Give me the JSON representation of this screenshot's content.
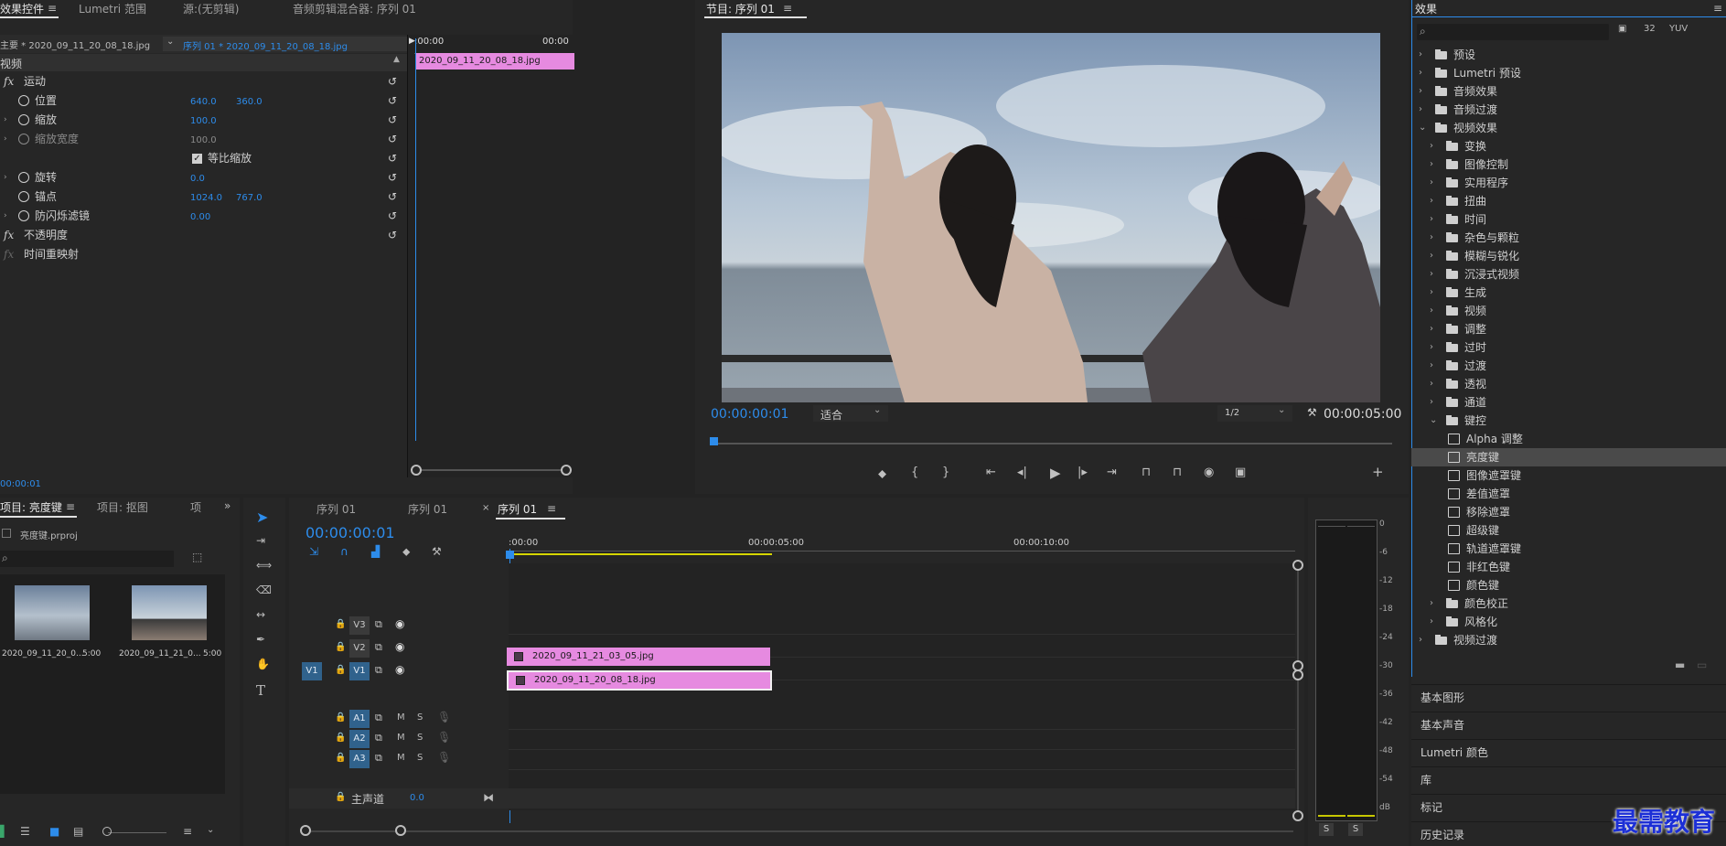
{
  "effect_controls": {
    "tabs": [
      "效果控件",
      "Lumetri 范围",
      "源:(无剪辑)",
      "音频剪辑混合器: 序列 01"
    ],
    "source_label": "主要 * 2020_09_11_20_08_18.jpg",
    "sequence_label": "序列 01 * 2020_09_11_20_08_18.jpg",
    "time_start": ":00:00",
    "time_end": "00:00",
    "section_video": "视频",
    "clip_name": "2020_09_11_20_08_18.jpg",
    "motion": "运动",
    "props": [
      {
        "name": "位置",
        "v1": "640.0",
        "v2": "360.0"
      },
      {
        "name": "缩放",
        "v1": "100.0",
        "v2": ""
      },
      {
        "name": "缩放宽度",
        "v1": "100.0",
        "v2": ""
      },
      {
        "name": "等比缩放",
        "v1": "",
        "v2": ""
      },
      {
        "name": "旋转",
        "v1": "0.0",
        "v2": ""
      },
      {
        "name": "锚点",
        "v1": "1024.0",
        "v2": "767.0"
      },
      {
        "name": "防闪烁滤镜",
        "v1": "0.00",
        "v2": ""
      }
    ],
    "opacity": "不透明度",
    "time_remap": "时间重映射",
    "bottom_time": "00:00:01"
  },
  "program": {
    "title": "节目: 序列 01",
    "timecode": "00:00:00:01",
    "fit": "适合",
    "resolution": "1/2",
    "duration": "00:00:05:00"
  },
  "effects": {
    "title": "效果",
    "search_placeholder": "",
    "items": [
      {
        "label": "预设",
        "level": 0,
        "type": "folder",
        "open": false
      },
      {
        "label": "Lumetri 预设",
        "level": 0,
        "type": "folder",
        "open": false
      },
      {
        "label": "音频效果",
        "level": 0,
        "type": "folder",
        "open": false
      },
      {
        "label": "音频过渡",
        "level": 0,
        "type": "folder",
        "open": false
      },
      {
        "label": "视频效果",
        "level": 0,
        "type": "folder",
        "open": true
      },
      {
        "label": "变换",
        "level": 1,
        "type": "folder",
        "open": false
      },
      {
        "label": "图像控制",
        "level": 1,
        "type": "folder",
        "open": false
      },
      {
        "label": "实用程序",
        "level": 1,
        "type": "folder",
        "open": false
      },
      {
        "label": "扭曲",
        "level": 1,
        "type": "folder",
        "open": false
      },
      {
        "label": "时间",
        "level": 1,
        "type": "folder",
        "open": false
      },
      {
        "label": "杂色与颗粒",
        "level": 1,
        "type": "folder",
        "open": false
      },
      {
        "label": "模糊与锐化",
        "level": 1,
        "type": "folder",
        "open": false
      },
      {
        "label": "沉浸式视频",
        "level": 1,
        "type": "folder",
        "open": false
      },
      {
        "label": "生成",
        "level": 1,
        "type": "folder",
        "open": false
      },
      {
        "label": "视频",
        "level": 1,
        "type": "folder",
        "open": false
      },
      {
        "label": "调整",
        "level": 1,
        "type": "folder",
        "open": false
      },
      {
        "label": "过时",
        "level": 1,
        "type": "folder",
        "open": false
      },
      {
        "label": "过渡",
        "level": 1,
        "type": "folder",
        "open": false
      },
      {
        "label": "透视",
        "level": 1,
        "type": "folder",
        "open": false
      },
      {
        "label": "通道",
        "level": 1,
        "type": "folder",
        "open": false
      },
      {
        "label": "键控",
        "level": 1,
        "type": "folder",
        "open": true
      },
      {
        "label": "Alpha 调整",
        "level": 2,
        "type": "fx",
        "open": false
      },
      {
        "label": "亮度键",
        "level": 2,
        "type": "fx",
        "open": false,
        "selected": true
      },
      {
        "label": "图像遮罩键",
        "level": 2,
        "type": "fx",
        "open": false
      },
      {
        "label": "差值遮罩",
        "level": 2,
        "type": "fx",
        "open": false
      },
      {
        "label": "移除遮罩",
        "level": 2,
        "type": "fx",
        "open": false
      },
      {
        "label": "超级键",
        "level": 2,
        "type": "fx",
        "open": false
      },
      {
        "label": "轨道遮罩键",
        "level": 2,
        "type": "fx",
        "open": false
      },
      {
        "label": "非红色键",
        "level": 2,
        "type": "fx",
        "open": false
      },
      {
        "label": "颜色键",
        "level": 2,
        "type": "fx",
        "open": false
      },
      {
        "label": "颜色校正",
        "level": 1,
        "type": "folder",
        "open": false
      },
      {
        "label": "风格化",
        "level": 1,
        "type": "folder",
        "open": false
      },
      {
        "label": "视频过渡",
        "level": 0,
        "type": "folder",
        "open": false
      }
    ],
    "lower_panels": [
      "基本图形",
      "基本声音",
      "Lumetri 颜色",
      "库",
      "标记",
      "历史记录"
    ]
  },
  "project": {
    "tabs": [
      "项目: 亮度键",
      "项目: 抠图",
      "项"
    ],
    "file": "亮度键.prproj",
    "thumbs": [
      {
        "name": "2020_09_11_20_0...",
        "dur": "5:00"
      },
      {
        "name": "2020_09_11_21_0...",
        "dur": "5:00"
      }
    ]
  },
  "timeline": {
    "tabs": [
      "序列 01",
      "序列 01",
      "序列 01"
    ],
    "timecode": "00:00:00:01",
    "ruler": [
      ":00:00",
      "00:00:05:00",
      "00:00:10:00"
    ],
    "tracks_video": [
      "V3",
      "V2",
      "V1"
    ],
    "tracks_audio": [
      "A1",
      "A2",
      "A3"
    ],
    "source_v": "V1",
    "master": "主声道",
    "master_val": "0.0",
    "clips": [
      {
        "track": "V2",
        "name": "2020_09_11_21_03_05.jpg"
      },
      {
        "track": "V1",
        "name": "2020_09_11_20_08_18.jpg"
      }
    ],
    "ms": [
      "M",
      "S"
    ]
  },
  "meter": {
    "scale": [
      "0",
      "-6",
      "-12",
      "-18",
      "-24",
      "-30",
      "-36",
      "-42",
      "-48",
      "-54",
      "dB"
    ],
    "s_labels": [
      "S",
      "S"
    ]
  },
  "watermark": "最需教育"
}
